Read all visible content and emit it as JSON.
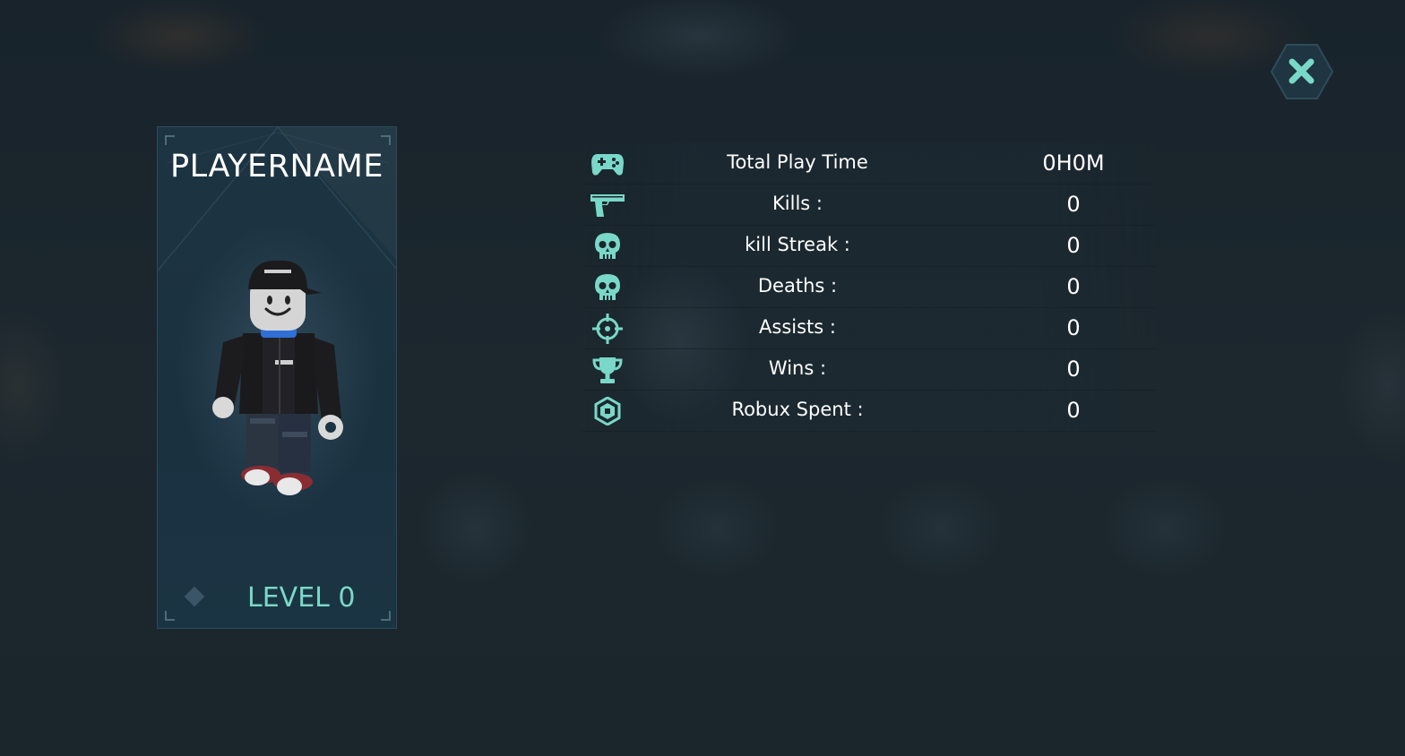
{
  "player": {
    "name": "PLAYERNAME",
    "level_label": "LEVEL 0"
  },
  "stats": [
    {
      "icon": "gamepad-icon",
      "label": "Total Play Time",
      "value": "0H0M"
    },
    {
      "icon": "pistol-icon",
      "label": "Kills :",
      "value": "0"
    },
    {
      "icon": "skull-icon",
      "label": "kill Streak :",
      "value": "0"
    },
    {
      "icon": "skull-icon",
      "label": "Deaths :",
      "value": "0"
    },
    {
      "icon": "crosshair-icon",
      "label": "Assists :",
      "value": "0"
    },
    {
      "icon": "trophy-icon",
      "label": "Wins :",
      "value": "0"
    },
    {
      "icon": "robux-icon",
      "label": "Robux Spent :",
      "value": "0"
    }
  ],
  "colors": {
    "accent": "#79d8c8",
    "background": "#1b262d",
    "card": "#1d3442"
  }
}
